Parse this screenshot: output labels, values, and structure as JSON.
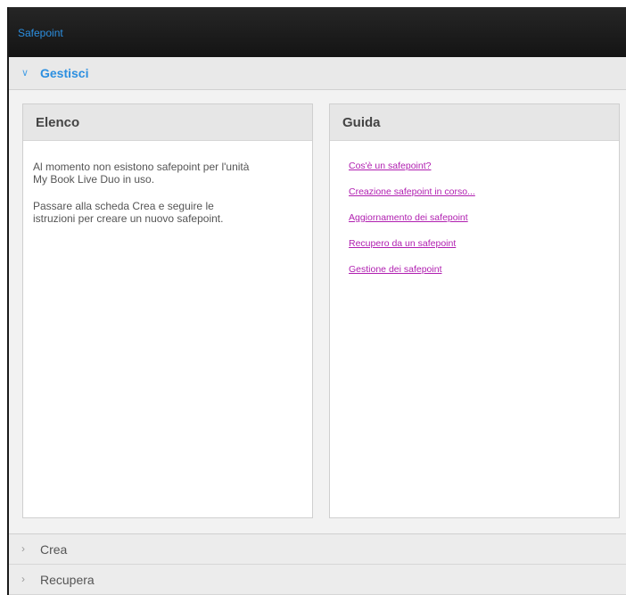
{
  "app": {
    "title": "Safepoint"
  },
  "sections": {
    "manage": {
      "label": "Gestisci",
      "expanded": true
    },
    "create": {
      "label": "Crea",
      "expanded": false
    },
    "recover": {
      "label": "Recupera",
      "expanded": false
    }
  },
  "list_panel": {
    "title": "Elenco",
    "paragraphs": [
      "Al momento non esistono safepoint per l'unità My Book Live Duo in uso.",
      "Passare alla scheda Crea e seguire le istruzioni per creare un nuovo safepoint."
    ]
  },
  "help_panel": {
    "title": "Guida",
    "links": [
      "Cos'è un safepoint?",
      "Creazione safepoint in corso...",
      "Aggiornamento dei safepoint",
      "Recupero da un safepoint",
      "Gestione dei safepoint"
    ]
  },
  "icons": {
    "expanded": "chevron-down-icon",
    "collapsed": "chevron-right-icon"
  },
  "colors": {
    "accent": "#2c8fe0",
    "link": "#b01fb0",
    "titlebar": "#1b1b1b"
  }
}
